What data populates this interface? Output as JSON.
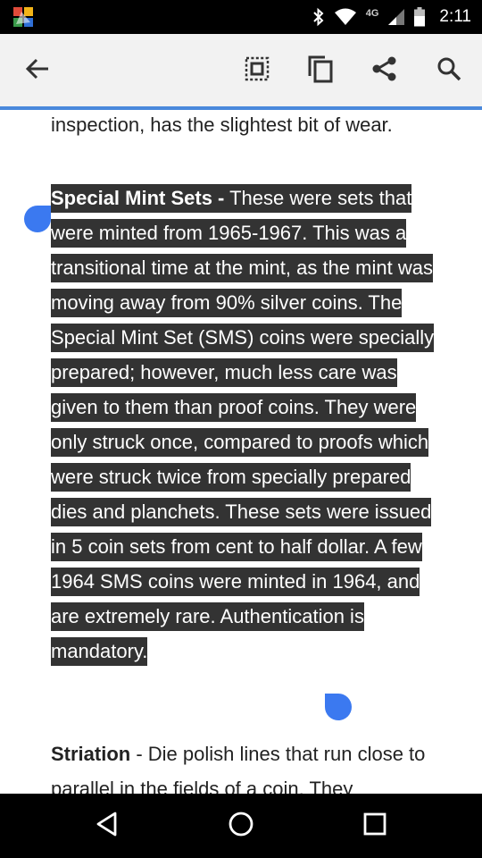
{
  "status_bar": {
    "network_label": "4G",
    "time": "2:11",
    "icons": [
      "app-shield-icon",
      "bluetooth-icon",
      "wifi-icon",
      "signal-icon",
      "battery-icon"
    ]
  },
  "action_bar": {
    "buttons": [
      "back-arrow-icon",
      "select-all-icon",
      "copy-icon",
      "share-icon",
      "search-icon"
    ],
    "accent_color": "#4a89dc"
  },
  "content": {
    "top_line": "inspection, has the slightest bit of wear.",
    "selected_paragraph": {
      "term": "Special Mint Sets -",
      "body": " These were sets that were minted from 1965-1967. This was a transitional time at the mint, as the mint was moving away from 90% silver coins. The Special Mint Set (SMS) coins were specially prepared; however, much less care was given to them than proof coins. They were only struck once, compared to proofs which were struck twice from specially prepared dies and planchets. These sets were issued in 5 coin sets from cent to half dollar. A few 1964 SMS coins were minted in 1964, and are extremely rare. Authentication is mandatory."
    },
    "next_paragraph": {
      "term": "Striation",
      "body": " - Die polish lines that run close to parallel in the fields of a coin. They"
    },
    "selection_color": "#333333",
    "handle_color": "#3b79f0"
  },
  "nav_bar": {
    "buttons": [
      "back-triangle-icon",
      "home-circle-icon",
      "recents-square-icon"
    ]
  }
}
